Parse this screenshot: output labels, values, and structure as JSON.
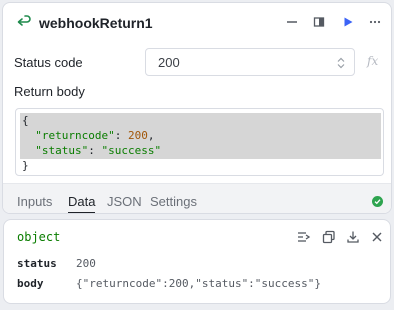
{
  "node": {
    "title": "webhookReturn1",
    "icon": "return-arrow-icon"
  },
  "header_actions": [
    "minimize-icon",
    "split-panel-icon",
    "run-icon",
    "more-icon"
  ],
  "status_code": {
    "label": "Status code",
    "value": "200",
    "fx_label": "fx"
  },
  "return_body": {
    "label": "Return body",
    "code": {
      "open": "{",
      "key1": "\"returncode\"",
      "val1": "200",
      "key2": "\"status\"",
      "val2": "\"success\"",
      "colon": ": ",
      "comma": ",",
      "close": "}"
    }
  },
  "tabs": [
    {
      "label": "Inputs"
    },
    {
      "label": "Data"
    },
    {
      "label": "JSON"
    },
    {
      "label": "Settings"
    }
  ],
  "active_tab": "Data",
  "colors": {
    "accent": "#3b63f6",
    "success": "#2ea44f",
    "string": "#0a7d00",
    "number": "#a1570a"
  },
  "output": {
    "type": "object",
    "fields": [
      {
        "key": "status",
        "value": "200"
      },
      {
        "key": "body",
        "value": "{\"returncode\":200,\"status\":\"success\"}"
      }
    ]
  }
}
